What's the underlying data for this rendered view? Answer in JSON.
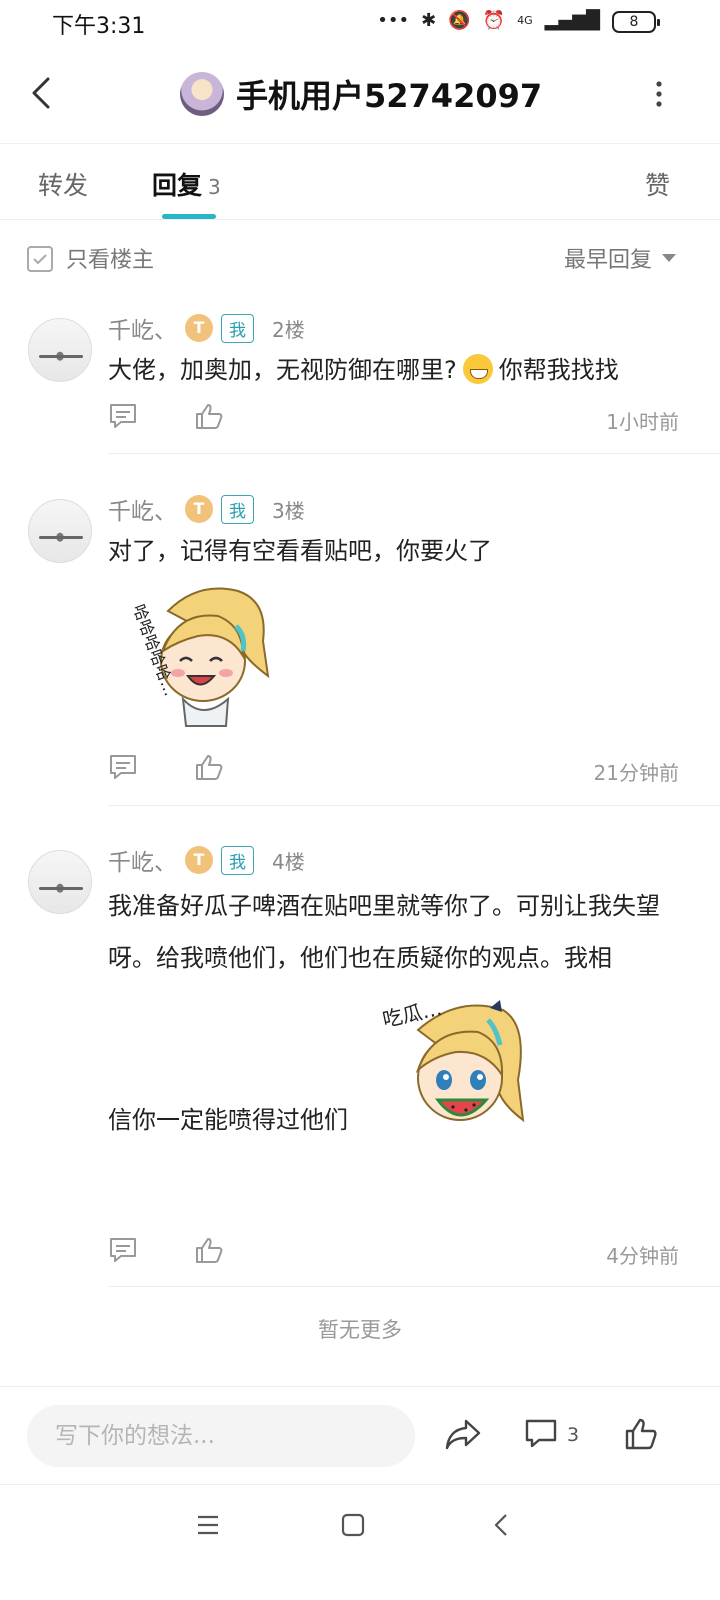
{
  "status_bar": {
    "time": "下午3:31",
    "network": "4G",
    "battery": "8"
  },
  "header": {
    "title": "手机用户52742097"
  },
  "tabs": {
    "repost": "转发",
    "reply": "回复",
    "reply_count": "3",
    "like": "赞"
  },
  "filter": {
    "only_op_label": "只看楼主",
    "sort_label": "最早回复"
  },
  "replies": [
    {
      "user": "千屹、",
      "level": "T",
      "me_badge": "我",
      "floor": "2楼",
      "text_before_emoji": "大佬，加奥加，无视防御在哪里?",
      "text_after_emoji": "你帮我找找",
      "time": "1小时前"
    },
    {
      "user": "千屹、",
      "level": "T",
      "me_badge": "我",
      "floor": "3楼",
      "text": "对了，记得有空看看贴吧，你要火了",
      "sticker_text": "哈哈哈哈哈…",
      "time": "21分钟前"
    },
    {
      "user": "千屹、",
      "level": "T",
      "me_badge": "我",
      "floor": "4楼",
      "text": "我准备好瓜子啤酒在贴吧里就等你了。可别让我失望呀。给我喷他们，他们也在质疑你的观点。我相",
      "text_tail": "信你一定能喷得过他们",
      "sticker_text": "吃瓜…",
      "time": "4分钟前"
    }
  ],
  "footer": {
    "no_more": "暂无更多"
  },
  "bottom_bar": {
    "placeholder": "写下你的想法...",
    "comment_count": "3"
  },
  "colors": {
    "accent": "#29b5c8",
    "badge": "#2a9fb2",
    "level": "#f0c27a"
  },
  "icons": [
    "back-arrow-icon",
    "more-vertical-icon",
    "comment-icon",
    "thumbs-up-icon",
    "share-icon",
    "menu-icon",
    "home-square-icon",
    "back-chevron-icon"
  ]
}
